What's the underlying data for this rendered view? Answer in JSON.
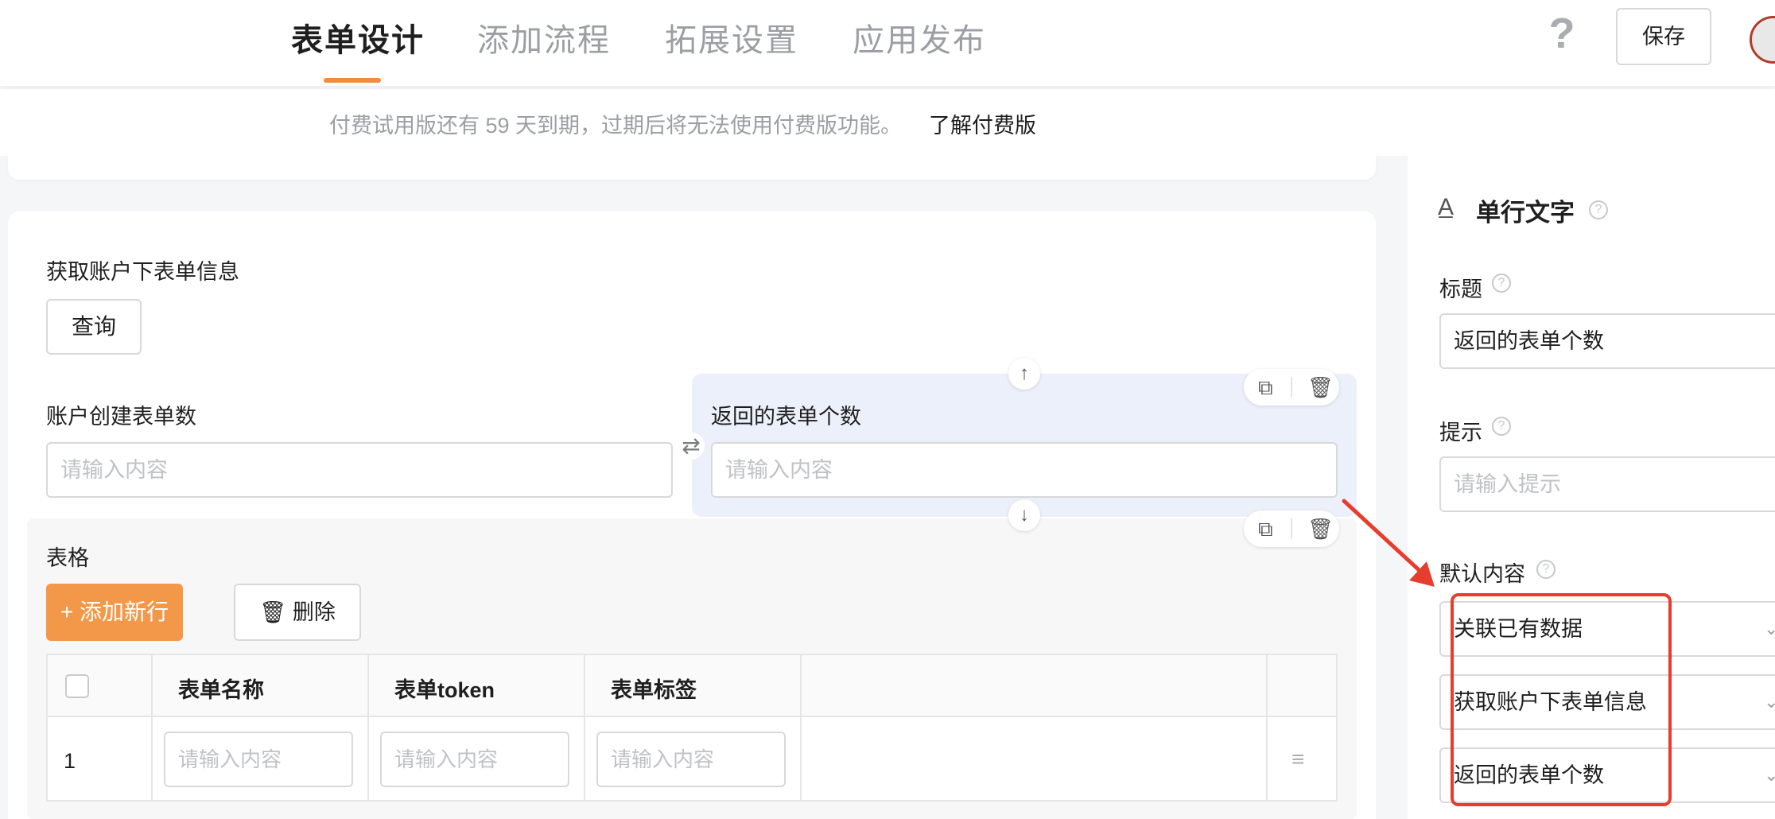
{
  "header": {
    "tabs": [
      {
        "label": "表单设计",
        "active": true
      },
      {
        "label": "添加流程",
        "active": false
      },
      {
        "label": "拓展设置",
        "active": false
      },
      {
        "label": "应用发布",
        "active": false
      }
    ],
    "help_icon": "question-mark-icon",
    "save_label": "保存"
  },
  "notice": {
    "text": "付费试用版还有 59 天到期，过期后将无法使用付费版功能。",
    "link": "了解付费版"
  },
  "form": {
    "fetch_section_label": "获取账户下表单信息",
    "query_button": "查询",
    "field_left": {
      "label": "账户创建表单数",
      "placeholder": "请输入内容"
    },
    "field_right": {
      "label": "返回的表单个数",
      "placeholder": "请输入内容"
    },
    "table": {
      "label": "表格",
      "add_button": "+ 添加新行",
      "delete_button": "删除",
      "columns": [
        "表单名称",
        "表单token",
        "表单标签"
      ],
      "rows": [
        {
          "index": "1",
          "cells": [
            "请输入内容",
            "请输入内容",
            "请输入内容"
          ]
        }
      ]
    }
  },
  "right_panel": {
    "title": "单行文字",
    "title_label": "标题",
    "title_value": "返回的表单个数",
    "hint_label": "提示",
    "hint_placeholder": "请输入提示",
    "default_label": "默认内容",
    "default_selects": [
      "关联已有数据",
      "获取账户下表单信息",
      "返回的表单个数"
    ]
  },
  "colors": {
    "accent": "#f08c3a",
    "primary_button": "#f39849",
    "selected_field_bg": "#ecf0fb",
    "annotation": "#e53e2e"
  }
}
